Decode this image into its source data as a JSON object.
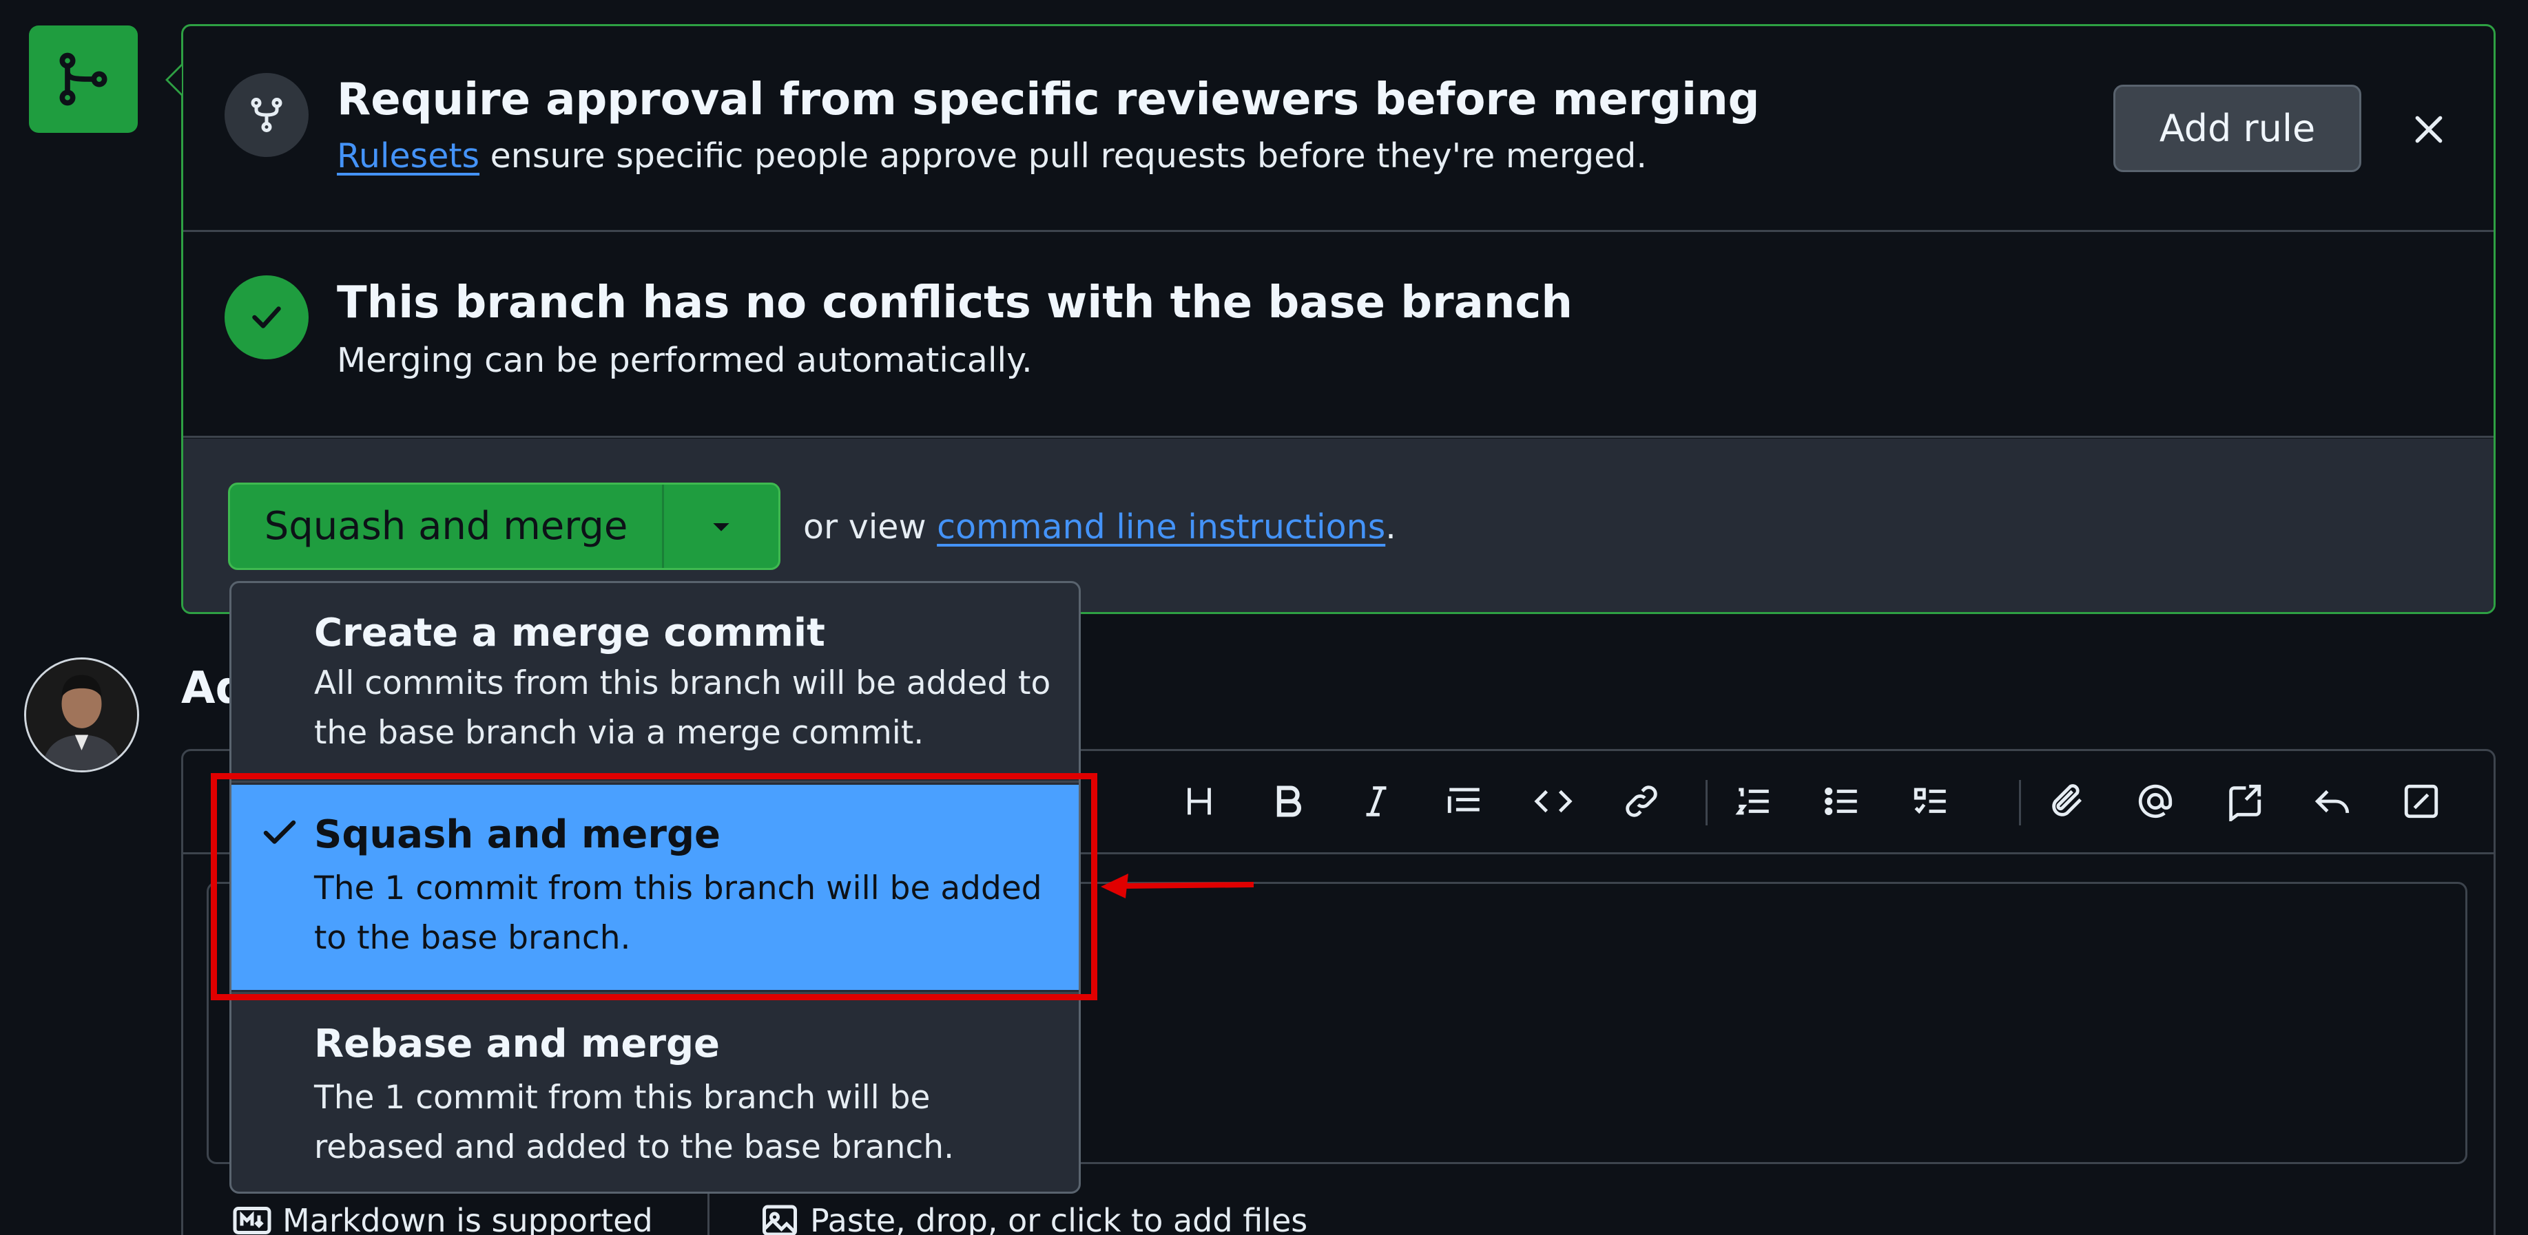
{
  "rulesets_notice": {
    "title": "Require approval from specific reviewers before merging",
    "link_text": "Rulesets",
    "description": " ensure specific people approve pull requests before they're merged.",
    "add_rule_label": "Add rule"
  },
  "conflicts": {
    "title": "This branch has no conflicts with the base branch",
    "description": "Merging can be performed automatically."
  },
  "merge_action": {
    "button_label": "Squash and merge",
    "or_view_text": "or view ",
    "command_line_link": "command line instructions",
    "period": "."
  },
  "merge_menu": {
    "items": [
      {
        "title": "Create a merge commit",
        "description": "All commits from this branch will be added to the base branch via a merge commit.",
        "selected": false
      },
      {
        "title": "Squash and merge",
        "description": "The 1 commit from this branch will be added to the base branch.",
        "selected": true
      },
      {
        "title": "Rebase and merge",
        "description": "The 1 commit from this branch will be rebased and added to the base branch.",
        "selected": false
      }
    ]
  },
  "comment": {
    "heading": "Ad",
    "footer_markdown": "Markdown is supported",
    "footer_files": "Paste, drop, or click to add files",
    "toolbar_icons": [
      "heading-icon",
      "bold-icon",
      "italic-icon",
      "quote-icon",
      "code-icon",
      "link-icon",
      "ordered-list-icon",
      "unordered-list-icon",
      "task-list-icon",
      "attach-icon",
      "mention-icon",
      "reference-icon",
      "reply-icon",
      "fullscreen-icon"
    ]
  },
  "colors": {
    "background": "#0d1117",
    "merge_green": "#1f9d3f",
    "link_blue": "#4493f8",
    "selected_item": "#4aa0ff",
    "annotation_red": "#e00000"
  }
}
